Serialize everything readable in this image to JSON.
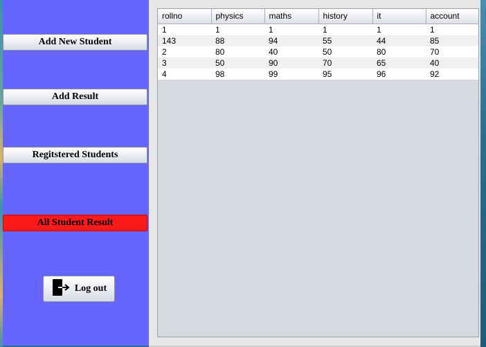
{
  "sidebar": {
    "buttons": [
      {
        "label": "Add New Student"
      },
      {
        "label": "Add Result"
      },
      {
        "label": "Regitstered Students"
      },
      {
        "label": "All Student Result"
      }
    ],
    "logout_label": "Log out",
    "active_color": "#ff1a1a",
    "background_color": "#6666ff"
  },
  "table": {
    "headers": [
      "rollno",
      "physics",
      "maths",
      "history",
      "it",
      "account"
    ],
    "rows": [
      [
        "1",
        "1",
        "1",
        "1",
        "1",
        "1"
      ],
      [
        "143",
        "88",
        "94",
        "55",
        "44",
        "85"
      ],
      [
        "2",
        "80",
        "40",
        "50",
        "80",
        "70"
      ],
      [
        "3",
        "50",
        "90",
        "70",
        "65",
        "40"
      ],
      [
        "4",
        "98",
        "99",
        "95",
        "96",
        "92"
      ]
    ]
  },
  "icons": {
    "logout": "logout-door-arrow-icon"
  }
}
